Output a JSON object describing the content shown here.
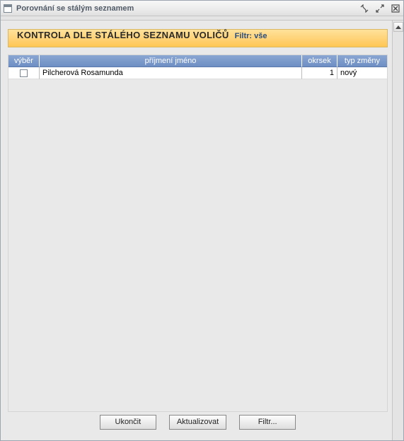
{
  "window": {
    "title": "Porovnání se stálým seznamem"
  },
  "header": {
    "title": "KONTROLA DLE STÁLÉHO SEZNAMU VOLIČŮ",
    "filter_label": "Filtr: vše"
  },
  "table": {
    "columns": {
      "vyber": "výběr",
      "jmeno": "příjmení jméno",
      "okrsek": "okrsek",
      "typ": "typ změny"
    },
    "rows": [
      {
        "checked": false,
        "jmeno": "Pilcherová Rosamunda",
        "okrsek": "1",
        "typ": "nový"
      }
    ]
  },
  "buttons": {
    "ukoncit": "Ukončit",
    "aktualizovat": "Aktualizovat",
    "filtr": "Filtr..."
  }
}
